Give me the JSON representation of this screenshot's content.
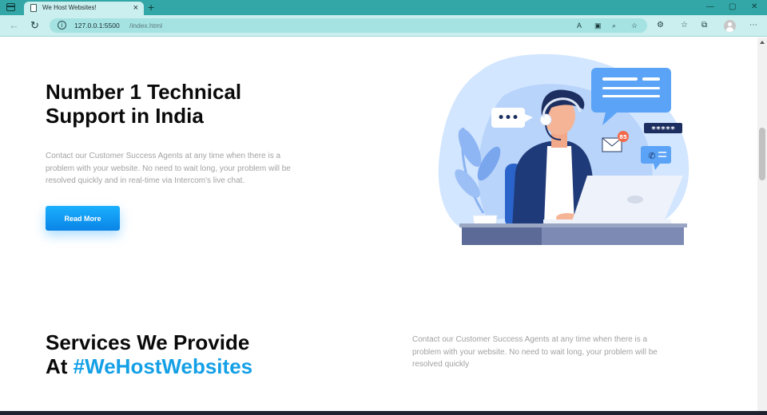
{
  "browser": {
    "tab_title": "We Host Websites!",
    "tab_close": "×",
    "new_tab": "+",
    "url_host": "127.0.0.1:5500",
    "url_path": "/index.html",
    "window_controls": [
      "—",
      "▢",
      "✕"
    ]
  },
  "hero": {
    "title": "Number 1 Technical Support in India",
    "description": "Contact our Customer Success Agents at any time when there is a problem with your website. No need to wait long, your problem will be resolved quickly and in real-time via Intercom's live chat.",
    "button_label": "Read More"
  },
  "illustration": {
    "notification_count": "85",
    "password_mask": "*****",
    "chat_dots": "•••"
  },
  "services": {
    "title_line1": "Services We Provide",
    "title_prefix": "At ",
    "title_hashtag": "#WeHostWebsites",
    "description": "Contact our Customer Success Agents at any time when there is a problem with your website. No need to wait long, your problem will be resolved quickly"
  },
  "colors": {
    "browser_accent": "#33a7a7",
    "button_blue": "#0a84e6",
    "hashtag_blue": "#14a0e6"
  }
}
